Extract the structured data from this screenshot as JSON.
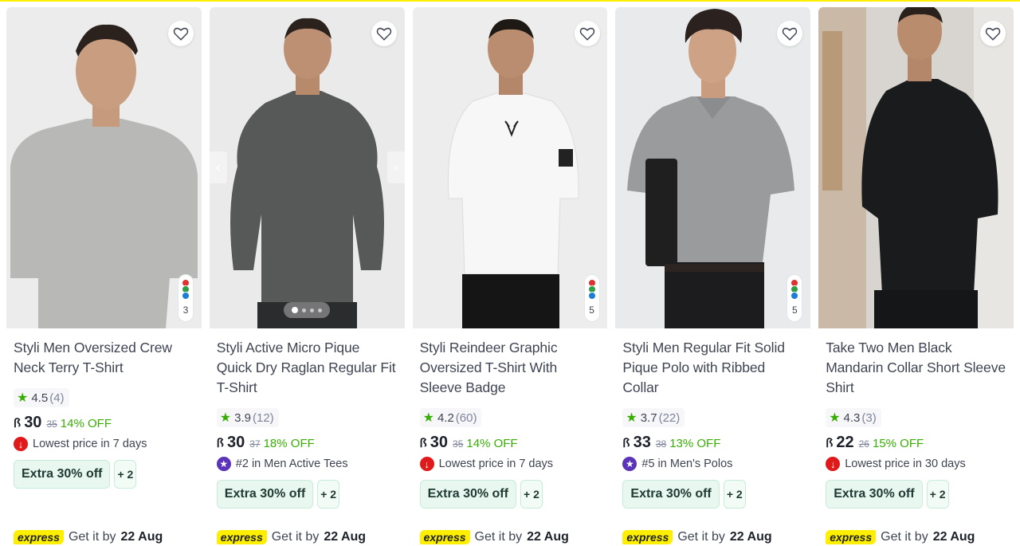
{
  "products": [
    {
      "title": "Styli Men Oversized Crew Neck Terry T-Shirt",
      "rating": "4.5",
      "rating_count": "(4)",
      "currency": "ꟗ",
      "price": "30",
      "old_price": "35",
      "discount": "14% OFF",
      "badge_text": "Lowest price in 7 days",
      "badge_icon": "arrow-down-icon",
      "extra_offer": "Extra 30% off",
      "more_offers": "+ 2",
      "delivery_label": "express",
      "delivery_text": "Get it by",
      "delivery_date": "22 Aug",
      "swatch_count": "3",
      "swatch_colors": [
        "#e03131",
        "#2f9e44",
        "#1c7ed6"
      ],
      "shirt_color": "#b8b9b7",
      "pants_color": "#d2d3d5"
    },
    {
      "title": "Styli Active Micro Pique Quick Dry Raglan Regular Fit T-Shirt",
      "rating": "3.9",
      "rating_count": "(12)",
      "currency": "ꟗ",
      "price": "30",
      "old_price": "37",
      "discount": "18% OFF",
      "badge_text": "#2 in Men Active Tees",
      "badge_icon": "star-rank-icon",
      "extra_offer": "Extra 30% off",
      "more_offers": "+ 2",
      "delivery_label": "express",
      "delivery_text": "Get it by",
      "delivery_date": "22 Aug",
      "swatch_count": "",
      "swatch_colors": [],
      "shirt_color": "#575858",
      "pants_color": "#2b2c2e"
    },
    {
      "title": "Styli Reindeer Graphic Oversized T-Shirt With Sleeve Badge",
      "rating": "4.2",
      "rating_count": "(60)",
      "currency": "ꟗ",
      "price": "30",
      "old_price": "35",
      "discount": "14% OFF",
      "badge_text": "Lowest price in 7 days",
      "badge_icon": "arrow-down-icon",
      "extra_offer": "Extra 30% off",
      "more_offers": "+ 2",
      "delivery_label": "express",
      "delivery_text": "Get it by",
      "delivery_date": "22 Aug",
      "swatch_count": "5",
      "swatch_colors": [
        "#e03131",
        "#2f9e44",
        "#1c7ed6"
      ],
      "shirt_color": "#f7f7f7",
      "pants_color": "#151515"
    },
    {
      "title": "Styli Men Regular Fit Solid Pique Polo with Ribbed Collar",
      "rating": "3.7",
      "rating_count": "(22)",
      "currency": "ꟗ",
      "price": "33",
      "old_price": "38",
      "discount": "13% OFF",
      "badge_text": "#5 in Men's Polos",
      "badge_icon": "star-rank-icon",
      "extra_offer": "Extra 30% off",
      "more_offers": "+ 2",
      "delivery_label": "express",
      "delivery_text": "Get it by",
      "delivery_date": "22 Aug",
      "swatch_count": "5",
      "swatch_colors": [
        "#e03131",
        "#2f9e44",
        "#1c7ed6"
      ],
      "shirt_color": "#9a9b9d",
      "pants_color": "#1c1c1e"
    },
    {
      "title": "Take Two Men Black Mandarin Collar Short Sleeve Shirt",
      "rating": "4.3",
      "rating_count": "(3)",
      "currency": "ꟗ",
      "price": "22",
      "old_price": "26",
      "discount": "15% OFF",
      "badge_text": "Lowest price in 30 days",
      "badge_icon": "arrow-down-icon",
      "extra_offer": "Extra 30% off",
      "more_offers": "+ 2",
      "delivery_label": "express",
      "delivery_text": "Get it by",
      "delivery_date": "22 Aug",
      "swatch_count": "",
      "swatch_colors": [],
      "shirt_color": "#1a1b1d",
      "pants_color": "#1a1b1d"
    }
  ],
  "colors": {
    "accent_yellow": "#feee00",
    "discount_green": "#38ae04",
    "badge_red": "#e01a1a",
    "rank_purple": "#5a33b8"
  }
}
